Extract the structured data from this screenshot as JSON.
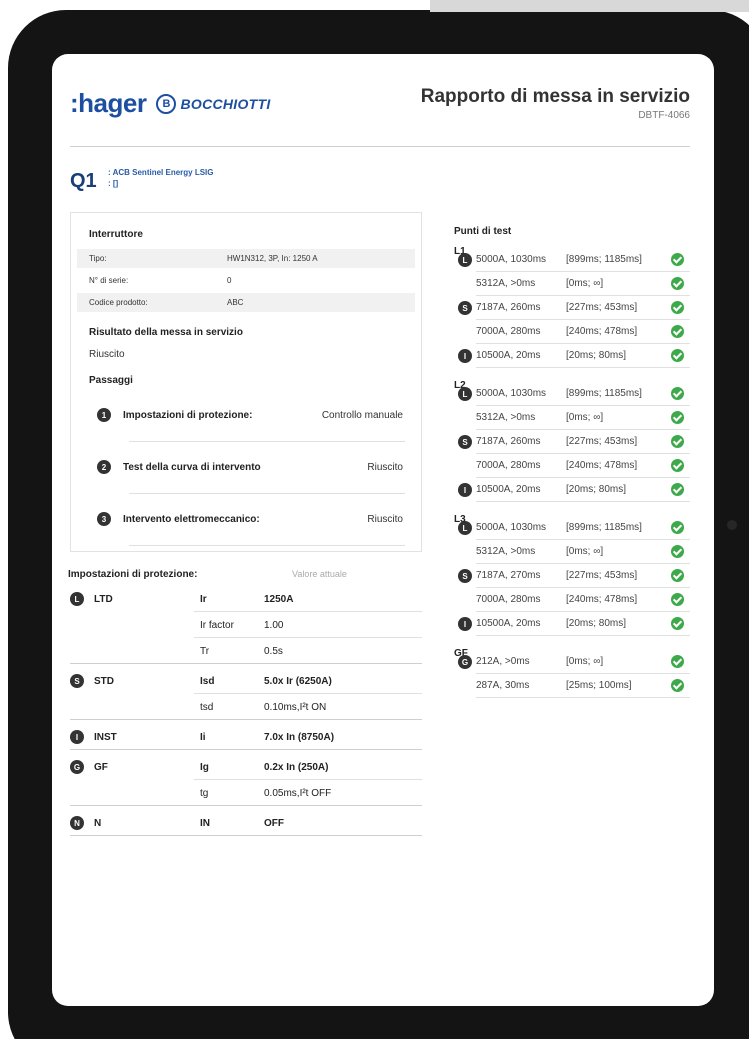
{
  "header": {
    "brand_hager": ":hager",
    "brand_bocchiotti_icon": "B",
    "brand_bocchiotti": "BOCCHIOTTI",
    "title": "Rapporto di messa in servizio",
    "doc_code": "DBTF-4066"
  },
  "device": {
    "label": "Q1",
    "line1": ": ACB Sentinel Energy LSIG",
    "line2": ": []"
  },
  "breaker": {
    "heading": "Interruttore",
    "rows": [
      {
        "key": "Tipo:",
        "value": "HW1N312, 3P, In: 1250 A"
      },
      {
        "key": "N° di serie:",
        "value": "0"
      },
      {
        "key": "Codice prodotto:",
        "value": "ABC"
      }
    ],
    "result_heading": "Risultato della messa in servizio",
    "result_value": "Riuscito",
    "steps_heading": "Passaggi",
    "steps": [
      {
        "num": "1",
        "label": "Impostazioni di protezione:",
        "result": "Controllo manuale"
      },
      {
        "num": "2",
        "label": "Test della curva di intervento",
        "result": "Riuscito"
      },
      {
        "num": "3",
        "label": "Intervento elettromeccanico:",
        "result": "Riuscito"
      }
    ]
  },
  "settings": {
    "heading": "Impostazioni di protezione:",
    "current_value_heading": "Valore attuale",
    "groups": [
      {
        "icon": "L",
        "name": "LTD",
        "params": [
          {
            "p": "Ir",
            "v": "1250A"
          },
          {
            "p": "Ir factor",
            "v": "1.00"
          },
          {
            "p": "Tr",
            "v": "0.5s"
          }
        ]
      },
      {
        "icon": "S",
        "name": "STD",
        "params": [
          {
            "p": "Isd",
            "v": "5.0x Ir (6250A)"
          },
          {
            "p": "tsd",
            "v": "0.10ms,I²t ON"
          }
        ]
      },
      {
        "icon": "I",
        "name": "INST",
        "params": [
          {
            "p": "Ii",
            "v": "7.0x In (8750A)"
          }
        ]
      },
      {
        "icon": "G",
        "name": "GF",
        "params": [
          {
            "p": "Ig",
            "v": "0.2x In (250A)"
          },
          {
            "p": "tg",
            "v": "0.05ms,I²t OFF"
          }
        ]
      },
      {
        "icon": "N",
        "name": "N",
        "params": [
          {
            "p": "IN",
            "v": "OFF"
          }
        ]
      }
    ]
  },
  "test_points": {
    "heading": "Punti di test",
    "phases": [
      {
        "name": "L1",
        "rows": [
          {
            "icon": "L",
            "a": "5000A, 1030ms",
            "r": "[899ms; 1185ms]"
          },
          {
            "icon": "",
            "a": "5312A, >0ms",
            "r": "[0ms; ∞]"
          },
          {
            "icon": "S",
            "a": "7187A, 260ms",
            "r": "[227ms; 453ms]"
          },
          {
            "icon": "",
            "a": "7000A, 280ms",
            "r": "[240ms; 478ms]"
          },
          {
            "icon": "I",
            "a": "10500A, 20ms",
            "r": "[20ms; 80ms]"
          }
        ]
      },
      {
        "name": "L2",
        "rows": [
          {
            "icon": "L",
            "a": "5000A, 1030ms",
            "r": "[899ms; 1185ms]"
          },
          {
            "icon": "",
            "a": "5312A, >0ms",
            "r": "[0ms; ∞]"
          },
          {
            "icon": "S",
            "a": "7187A, 260ms",
            "r": "[227ms; 453ms]"
          },
          {
            "icon": "",
            "a": "7000A, 280ms",
            "r": "[240ms; 478ms]"
          },
          {
            "icon": "I",
            "a": "10500A, 20ms",
            "r": "[20ms; 80ms]"
          }
        ]
      },
      {
        "name": "L3",
        "rows": [
          {
            "icon": "L",
            "a": "5000A, 1030ms",
            "r": "[899ms; 1185ms]"
          },
          {
            "icon": "",
            "a": "5312A, >0ms",
            "r": "[0ms; ∞]"
          },
          {
            "icon": "S",
            "a": "7187A, 270ms",
            "r": "[227ms; 453ms]"
          },
          {
            "icon": "",
            "a": "7000A, 280ms",
            "r": "[240ms; 478ms]"
          },
          {
            "icon": "I",
            "a": "10500A, 20ms",
            "r": "[20ms; 80ms]"
          }
        ]
      },
      {
        "name": "GF",
        "rows": [
          {
            "icon": "G",
            "a": "212A, >0ms",
            "r": "[0ms; ∞]"
          },
          {
            "icon": "",
            "a": "287A, 30ms",
            "r": "[25ms; 100ms]"
          }
        ]
      }
    ],
    "status_color": "#3ea94a"
  }
}
